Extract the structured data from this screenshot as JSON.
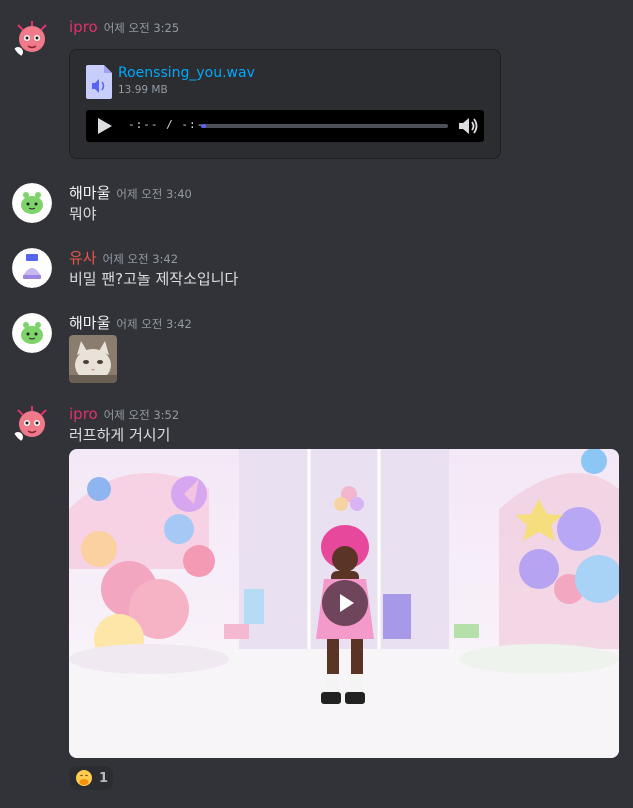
{
  "messages": {
    "m1": {
      "user": "ipro",
      "user_color": "#e0316b",
      "time": "어제 오전 3:25"
    },
    "m2": {
      "user": "해마울",
      "user_color": "#f2f3f5",
      "time": "어제 오전 3:40",
      "text": "뭐야"
    },
    "m3": {
      "user": "유사",
      "user_color": "#e8574a",
      "time": "어제 오전 3:42",
      "text": "비밀 팬?고놀 제작소입니다"
    },
    "m4": {
      "user": "해마울",
      "user_color": "#f2f3f5",
      "time": "어제 오전 3:42"
    },
    "m5": {
      "user": "ipro",
      "user_color": "#e0316b",
      "time": "어제 오전 3:52",
      "text": "러프하게 거시기"
    }
  },
  "attachment": {
    "file_name": "Roenssing_you.wav",
    "file_size": "13.99 MB",
    "time_display": "-:-- / -:--",
    "progress": 0.02,
    "file_icon": "audio-file-icon",
    "play_icon": "play-icon",
    "volume_icon": "volume-icon"
  },
  "video": {
    "play_icon": "play-icon"
  },
  "reaction": {
    "emoji": "hand-over-mouth-emoji",
    "count": "1"
  },
  "colors": {
    "background": "#313338",
    "card": "#2b2d31",
    "link": "#00a8fc",
    "accent": "#5865f2"
  }
}
